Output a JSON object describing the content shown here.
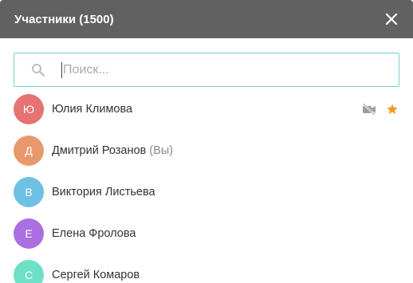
{
  "header": {
    "title": "Участники (1500)",
    "close_icon": "close-icon"
  },
  "search": {
    "placeholder": "Поиск...",
    "value": "",
    "icon": "search-icon",
    "border_color": "#7ccfcf"
  },
  "participants": [
    {
      "initial": "Ю",
      "name": "Юлия Климова",
      "suffix": "",
      "color": "#e57373",
      "icons": [
        "video-off-icon",
        "star-icon"
      ]
    },
    {
      "initial": "Д",
      "name": "Дмитрий Розанов",
      "suffix": "(Вы)",
      "color": "#e8996b",
      "icons": []
    },
    {
      "initial": "В",
      "name": "Виктория Листьева",
      "suffix": "",
      "color": "#6ec1e4",
      "icons": []
    },
    {
      "initial": "Е",
      "name": "Елена Фролова",
      "suffix": "",
      "color": "#ab6fe0",
      "icons": []
    },
    {
      "initial": "С",
      "name": "Сергей Комаров",
      "suffix": "",
      "color": "#6fe0c8",
      "icons": []
    }
  ],
  "colors": {
    "header_bg": "#616161",
    "star": "#f39a2b",
    "video_off": "#9e9e9e"
  }
}
